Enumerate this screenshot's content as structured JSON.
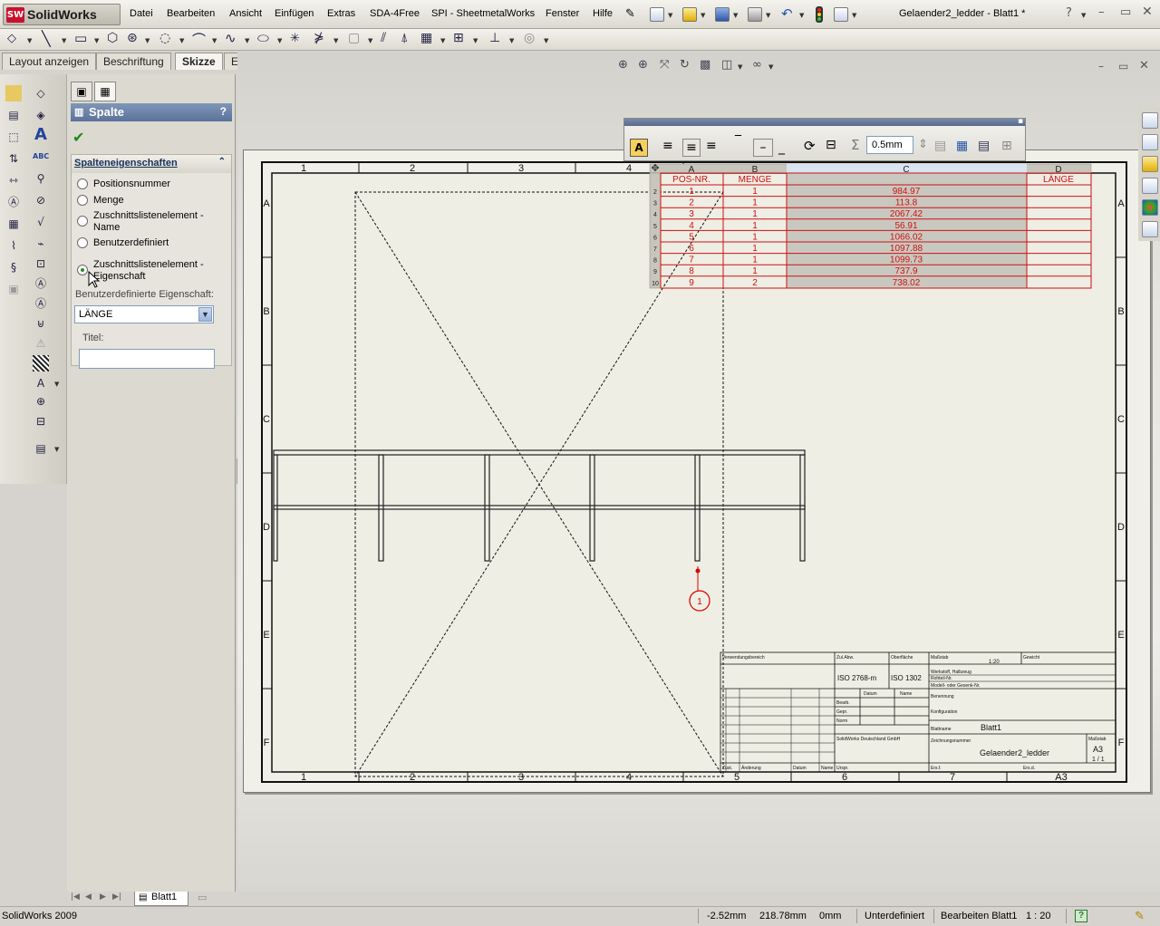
{
  "app": {
    "logo_text": "SolidWorks",
    "window_title": "Gelaender2_ledder - Blatt1 *"
  },
  "menu": [
    "Datei",
    "Bearbeiten",
    "Ansicht",
    "Einfügen",
    "Extras",
    "SDA-4Free",
    "SPI - SheetmetalWorks",
    "Fenster",
    "Hilfe"
  ],
  "tabs": [
    "Layout anzeigen",
    "Beschriftung",
    "Skizze",
    "Evaluieren"
  ],
  "active_tab": "Skizze",
  "pm": {
    "title": "Spalte",
    "help": "?",
    "group_title": "Spalteneigenschaften",
    "radios": [
      {
        "label": "Positionsnummer",
        "checked": false
      },
      {
        "label": "Menge",
        "checked": false
      },
      {
        "label": "Zuschnittslistenelement - Name",
        "checked": false
      },
      {
        "label": "Benutzerdefiniert",
        "checked": false
      },
      {
        "label": "Zuschnittslistenelement - Eigenschaft",
        "checked": true
      }
    ],
    "custom_prop_label": "Benutzerdefinierte Eigenschaft:",
    "custom_prop_value": "LÄNGE",
    "title_label": "Titel:",
    "title_value": ""
  },
  "table_toolbar": {
    "font_size": "0.5mm"
  },
  "table": {
    "col_letters": [
      "A",
      "B",
      "C",
      "D"
    ],
    "headers": [
      "POS-NR.",
      "MENGE",
      "",
      "LÄNGE"
    ],
    "rows": [
      {
        "rn": "2",
        "pos": "1",
        "qty": "1",
        "c": "984.97",
        "len": ""
      },
      {
        "rn": "3",
        "pos": "2",
        "qty": "1",
        "c": "113.8",
        "len": ""
      },
      {
        "rn": "4",
        "pos": "3",
        "qty": "1",
        "c": "2067.42",
        "len": ""
      },
      {
        "rn": "5",
        "pos": "4",
        "qty": "1",
        "c": "56.91",
        "len": ""
      },
      {
        "rn": "6",
        "pos": "5",
        "qty": "1",
        "c": "1066.02",
        "len": ""
      },
      {
        "rn": "7",
        "pos": "6",
        "qty": "1",
        "c": "1097.88",
        "len": ""
      },
      {
        "rn": "8",
        "pos": "7",
        "qty": "1",
        "c": "1099.73",
        "len": ""
      },
      {
        "rn": "9",
        "pos": "8",
        "qty": "1",
        "c": "737.9",
        "len": ""
      },
      {
        "rn": "10",
        "pos": "9",
        "qty": "2",
        "c": "738.02",
        "len": ""
      }
    ]
  },
  "drawing": {
    "zones_top": [
      "1",
      "2",
      "3",
      "4"
    ],
    "zones_bottom": [
      "1",
      "2",
      "3",
      "4",
      "5",
      "6",
      "7",
      "A3"
    ],
    "zones_side": [
      "A",
      "B",
      "C",
      "D",
      "E",
      "F"
    ],
    "balloon": "1",
    "title_block": {
      "sheet_name_label": "Blattname",
      "sheet_name": "Blatt1",
      "drawing_no_label": "Zeichnungsnummer",
      "drawing_no": "Gelaender2_ledder",
      "format": "A3",
      "page": "1 / 1",
      "tol1": "ISO 2768-m",
      "tol2": "ISO 1302",
      "scale": "1:20",
      "hdr_verwendung": "Verwendungsbereich",
      "hdr_zulabw": "Zul.Abw.",
      "hdr_oberflaeche": "Oberfläche",
      "hdr_massstab": "Maßstab",
      "hdr_gewicht": "Gewicht",
      "hdr_werkstoff": "Werkstoff, Halbzeug",
      "hdr_rohteil": "Rohteil-Nr.",
      "hdr_modell": "Modell- oder Gesenk-Nr.",
      "hdr_benennung": "Benennung",
      "hdr_konfig": "Konfiguration",
      "hdr_datum": "Datum",
      "hdr_name": "Name",
      "hdr_bearb": "Bearb.",
      "hdr_gepr": "Gepr.",
      "hdr_norm": "Norm",
      "hdr_aenderung": "Änderung",
      "hdr_urspr": "Urspr.",
      "hdr_ersf": "Ers.f.",
      "hdr_ersd": "Ers.d.",
      "hdr_zust": "Zust.",
      "company": "SolidWorks Deutschland GmbH"
    }
  },
  "sheet_tab": "Blatt1",
  "status": {
    "app_version": "SolidWorks 2009",
    "x": "-2.52mm",
    "y": "218.78mm",
    "z": "0mm",
    "state": "Unterdefiniert",
    "mode": "Bearbeiten Blatt1",
    "scale": "1 : 20",
    "help": "?"
  }
}
